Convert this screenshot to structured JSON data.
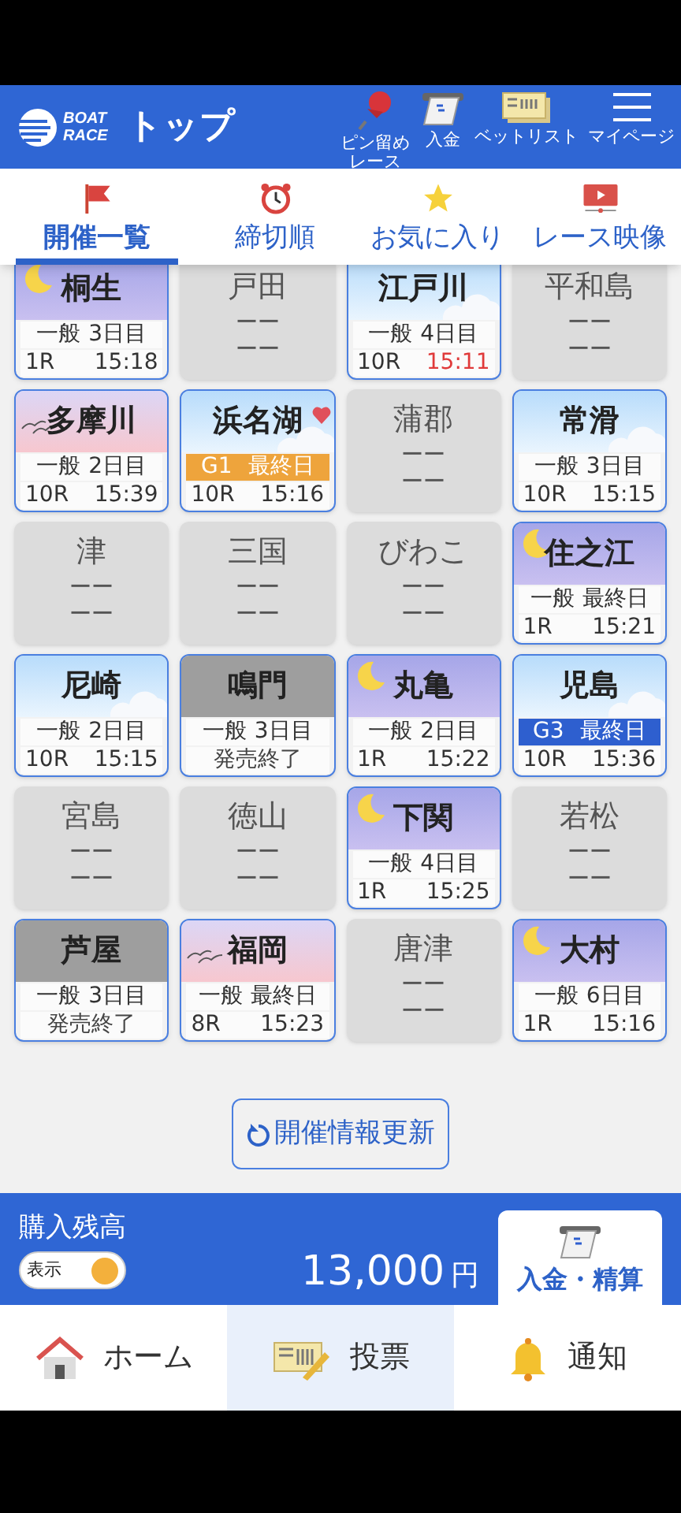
{
  "header": {
    "logo_top": "BOAT",
    "logo_bottom": "RACE",
    "title": "トップ",
    "actions": [
      {
        "kind": "pin",
        "label": "ピン留めレース"
      },
      {
        "kind": "deposit",
        "label": "入金"
      },
      {
        "kind": "betlist",
        "label": "ベットリスト"
      },
      {
        "kind": "menu",
        "label": "マイページ"
      }
    ]
  },
  "tabs": [
    {
      "kind": "flag",
      "label": "開催一覧",
      "selected": true
    },
    {
      "kind": "clock",
      "label": "締切順",
      "selected": false
    },
    {
      "kind": "star",
      "label": "お気に入り",
      "selected": false
    },
    {
      "kind": "video",
      "label": "レース映像",
      "selected": false
    }
  ],
  "venues": [
    {
      "name": "桐生",
      "kind": "night",
      "series": "一般",
      "day": "3日目",
      "race": "1R",
      "time": "15:18",
      "urgent": false,
      "favorite": false
    },
    {
      "name": "戸田",
      "kind": "closed",
      "lines": [
        "ーー",
        "ーー"
      ]
    },
    {
      "name": "江戸川",
      "kind": "day",
      "series": "一般",
      "day": "4日目",
      "race": "10R",
      "time": "15:11",
      "urgent": true,
      "favorite": false
    },
    {
      "name": "平和島",
      "kind": "closed",
      "lines": [
        "ーー",
        "ーー"
      ]
    },
    {
      "name": "多摩川",
      "kind": "dusk",
      "series": "一般",
      "day": "2日目",
      "race": "10R",
      "time": "15:39",
      "urgent": false,
      "favorite": false
    },
    {
      "name": "浜名湖",
      "kind": "day",
      "series": "G1",
      "day": "最終日",
      "color": "#eea43c",
      "race": "10R",
      "time": "15:16",
      "urgent": false,
      "favorite": true
    },
    {
      "name": "蒲郡",
      "kind": "closed",
      "lines": [
        "ーー",
        "ーー"
      ]
    },
    {
      "name": "常滑",
      "kind": "day",
      "series": "一般",
      "day": "3日目",
      "race": "10R",
      "time": "15:15",
      "urgent": false,
      "favorite": false
    },
    {
      "name": "津",
      "kind": "closed",
      "lines": [
        "ーー",
        "ーー"
      ]
    },
    {
      "name": "三国",
      "kind": "closed",
      "lines": [
        "ーー",
        "ーー"
      ]
    },
    {
      "name": "びわこ",
      "kind": "closed",
      "lines": [
        "ーー",
        "ーー"
      ]
    },
    {
      "name": "住之江",
      "kind": "night",
      "series": "一般",
      "day": "最終日",
      "race": "1R",
      "time": "15:21",
      "urgent": false,
      "favorite": false
    },
    {
      "name": "尼崎",
      "kind": "day",
      "series": "一般",
      "day": "2日目",
      "race": "10R",
      "time": "15:15",
      "urgent": false,
      "favorite": false
    },
    {
      "name": "鳴門",
      "kind": "sold_out",
      "series": "一般",
      "day": "3日目",
      "status": "発売終了"
    },
    {
      "name": "丸亀",
      "kind": "night",
      "series": "一般",
      "day": "2日目",
      "race": "1R",
      "time": "15:22",
      "urgent": false,
      "favorite": false
    },
    {
      "name": "児島",
      "kind": "day",
      "series": "G3",
      "day": "最終日",
      "color": "#2e5fcf",
      "race": "10R",
      "time": "15:36",
      "urgent": false,
      "favorite": false
    },
    {
      "name": "宮島",
      "kind": "closed",
      "lines": [
        "ーー",
        "ーー"
      ]
    },
    {
      "name": "徳山",
      "kind": "closed",
      "lines": [
        "ーー",
        "ーー"
      ]
    },
    {
      "name": "下関",
      "kind": "night",
      "series": "一般",
      "day": "4日目",
      "race": "1R",
      "time": "15:25",
      "urgent": false,
      "favorite": false
    },
    {
      "name": "若松",
      "kind": "closed",
      "lines": [
        "ーー",
        "ーー"
      ]
    },
    {
      "name": "芦屋",
      "kind": "sold_out",
      "series": "一般",
      "day": "3日目",
      "status": "発売終了"
    },
    {
      "name": "福岡",
      "kind": "dusk",
      "series": "一般",
      "day": "最終日",
      "race": "8R",
      "time": "15:23",
      "urgent": false,
      "favorite": false
    },
    {
      "name": "唐津",
      "kind": "closed",
      "lines": [
        "ーー",
        "ーー"
      ]
    },
    {
      "name": "大村",
      "kind": "night",
      "series": "一般",
      "day": "6日目",
      "race": "1R",
      "time": "15:16",
      "urgent": false,
      "favorite": false
    }
  ],
  "refresh_button": "開催情報更新",
  "balance": {
    "label": "購入残高",
    "toggle_label": "表示",
    "toggle_on": true,
    "amount": "13,000",
    "unit": "円",
    "deposit_button": "入金・精算"
  },
  "bottom_nav": [
    {
      "kind": "home",
      "label": "ホーム",
      "selected": false
    },
    {
      "kind": "vote",
      "label": "投票",
      "selected": true
    },
    {
      "kind": "bell",
      "label": "通知",
      "selected": false
    }
  ]
}
